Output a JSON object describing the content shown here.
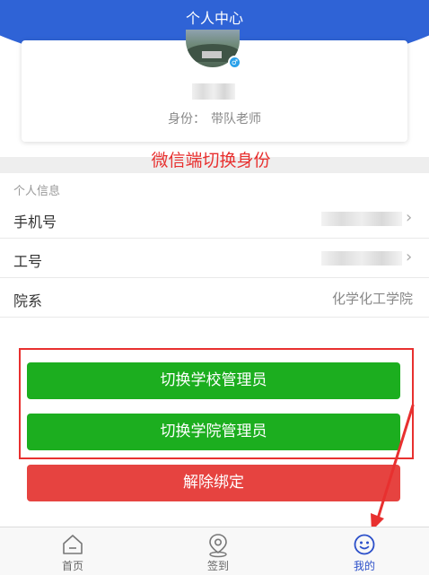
{
  "header": {
    "title": "个人中心"
  },
  "profile": {
    "identity_label": "身份：",
    "identity_value": "带队老师",
    "gender_symbol": "♂"
  },
  "annotation": {
    "text": "微信端切换身份"
  },
  "info": {
    "section_label": "个人信息",
    "rows": [
      {
        "label": "手机号",
        "value": "",
        "chevron": "›"
      },
      {
        "label": "工号",
        "value": "",
        "chevron": "›"
      },
      {
        "label": "院系",
        "value": "化学化工学院"
      }
    ]
  },
  "actions": {
    "switch_school_admin": "切换学校管理员",
    "switch_college_admin": "切换学院管理员",
    "unbind": "解除绑定"
  },
  "tabbar": {
    "items": [
      {
        "label": "首页",
        "icon": "home-icon"
      },
      {
        "label": "签到",
        "icon": "location-icon"
      },
      {
        "label": "我的",
        "icon": "smile-icon",
        "active": true
      }
    ]
  },
  "colors": {
    "brand_blue": "#2f63d6",
    "green": "#1cae1f",
    "red": "#e64340",
    "annotation_red": "#e8302f"
  }
}
